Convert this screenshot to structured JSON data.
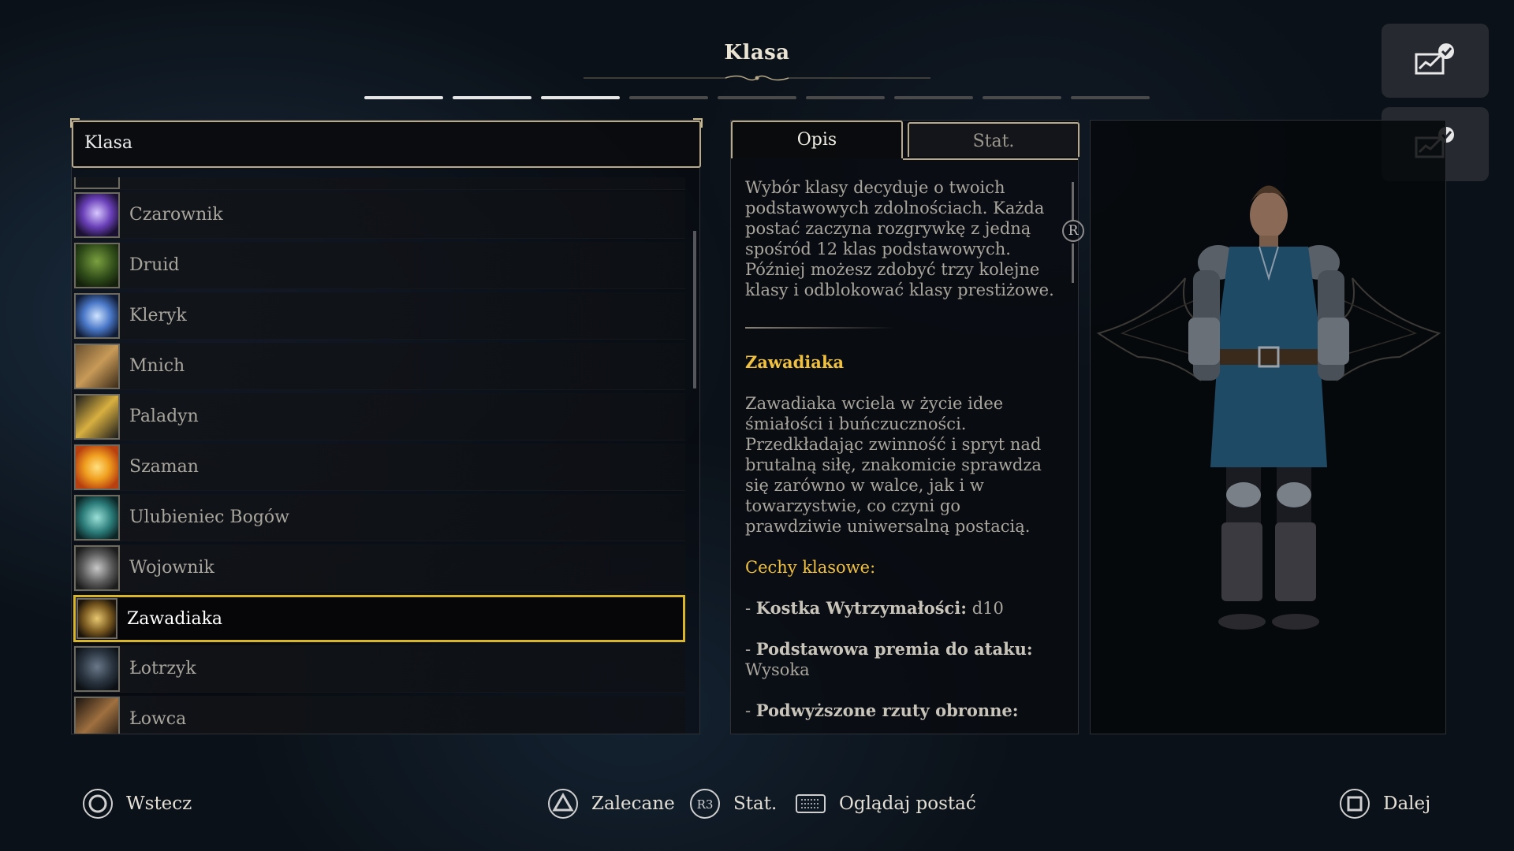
{
  "header": {
    "title": "Klasa",
    "steps_total": 9,
    "steps_completed": 3
  },
  "corner_buttons": [
    {
      "icon": "chart-check-icon"
    },
    {
      "icon": "chart-check-icon"
    }
  ],
  "class_list": {
    "header": "Klasa",
    "items": [
      {
        "label": "Czarownik",
        "icon": "sorcerer-icon",
        "selected": false
      },
      {
        "label": "Druid",
        "icon": "druid-tree-icon",
        "selected": false
      },
      {
        "label": "Kleryk",
        "icon": "cleric-icon",
        "selected": false
      },
      {
        "label": "Mnich",
        "icon": "monk-fist-icon",
        "selected": false
      },
      {
        "label": "Paladyn",
        "icon": "paladin-sword-icon",
        "selected": false
      },
      {
        "label": "Szaman",
        "icon": "shaman-spiral-icon",
        "selected": false
      },
      {
        "label": "Ulubieniec Bogów",
        "icon": "favored-soul-icon",
        "selected": false
      },
      {
        "label": "Wojownik",
        "icon": "fighter-icon",
        "selected": false
      },
      {
        "label": "Zawadiaka",
        "icon": "swashbuckler-icon",
        "selected": true
      },
      {
        "label": "Łotrzyk",
        "icon": "rogue-icon",
        "selected": false
      },
      {
        "label": "Łowca",
        "icon": "ranger-bow-icon",
        "selected": false
      }
    ]
  },
  "description": {
    "tabs": [
      {
        "label": "Opis",
        "active": true
      },
      {
        "label": "Stat.",
        "active": false
      }
    ],
    "scroll_badge": "R",
    "intro": "Wybór klasy decyduje o twoich podstawowych zdolnościach. Każda postać zaczyna rozgrywkę z jedną spośród 12 klas podstawowych. Później możesz zdobyć trzy kolejne klasy i odblokować klasy prestiżowe.",
    "class_name": "Zawadiaka",
    "class_text": "Zawadiaka wciela w życie idee śmiałości i buńczuczności. Przedkładając zwinność i spryt nad brutalną siłę, znakomicie sprawdza się zarówno w walce, jak i w towarzystwie, co czyni go prawdziwie uniwersalną postacią.",
    "traits_title": "Cechy klasowe:",
    "traits": [
      {
        "name": "Kostka Wytrzymałości:",
        "value": "d10"
      },
      {
        "name": "Podstawowa premia do ataku:",
        "value": "Wysoka"
      },
      {
        "name": "Podwyższone rzuty obronne:",
        "value": ""
      }
    ]
  },
  "footer": {
    "back": {
      "label": "Wstecz",
      "button": "circle-button-icon"
    },
    "recommended": {
      "label": "Zalecane",
      "button": "triangle-button-icon"
    },
    "stats": {
      "label": "Stat.",
      "button_text": "R3"
    },
    "view_character": {
      "label": "Oglądaj postać",
      "button": "touchpad-button-icon"
    },
    "next": {
      "label": "Dalej",
      "button": "square-button-icon"
    }
  },
  "colors": {
    "accent_gold": "#d9b52a",
    "title_yellow": "#f0c040",
    "frame_tan": "#b8a98a"
  }
}
